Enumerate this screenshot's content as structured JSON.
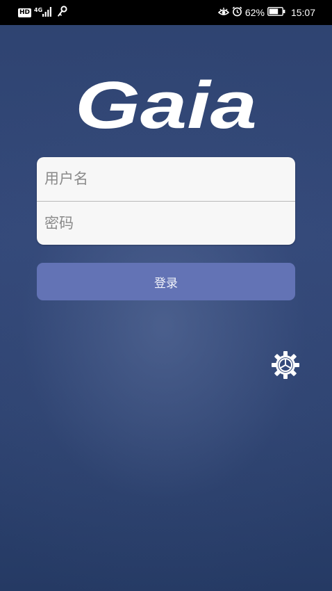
{
  "status_bar": {
    "hd_badge": "HD",
    "network": "4G",
    "battery_percent": "62%",
    "time": "15:07"
  },
  "logo": {
    "text": "Gaia"
  },
  "login": {
    "username_placeholder": "用户名",
    "password_placeholder": "密码",
    "submit_label": "登录"
  },
  "icons": {
    "signal": "signal-bars-icon",
    "key": "key-icon",
    "eye": "eye-icon",
    "alarm": "alarm-clock-icon",
    "battery": "battery-icon",
    "settings": "gear-icon"
  },
  "colors": {
    "background": "#2e4370",
    "button": "#6373b5",
    "form_background": "#f7f7f7"
  }
}
